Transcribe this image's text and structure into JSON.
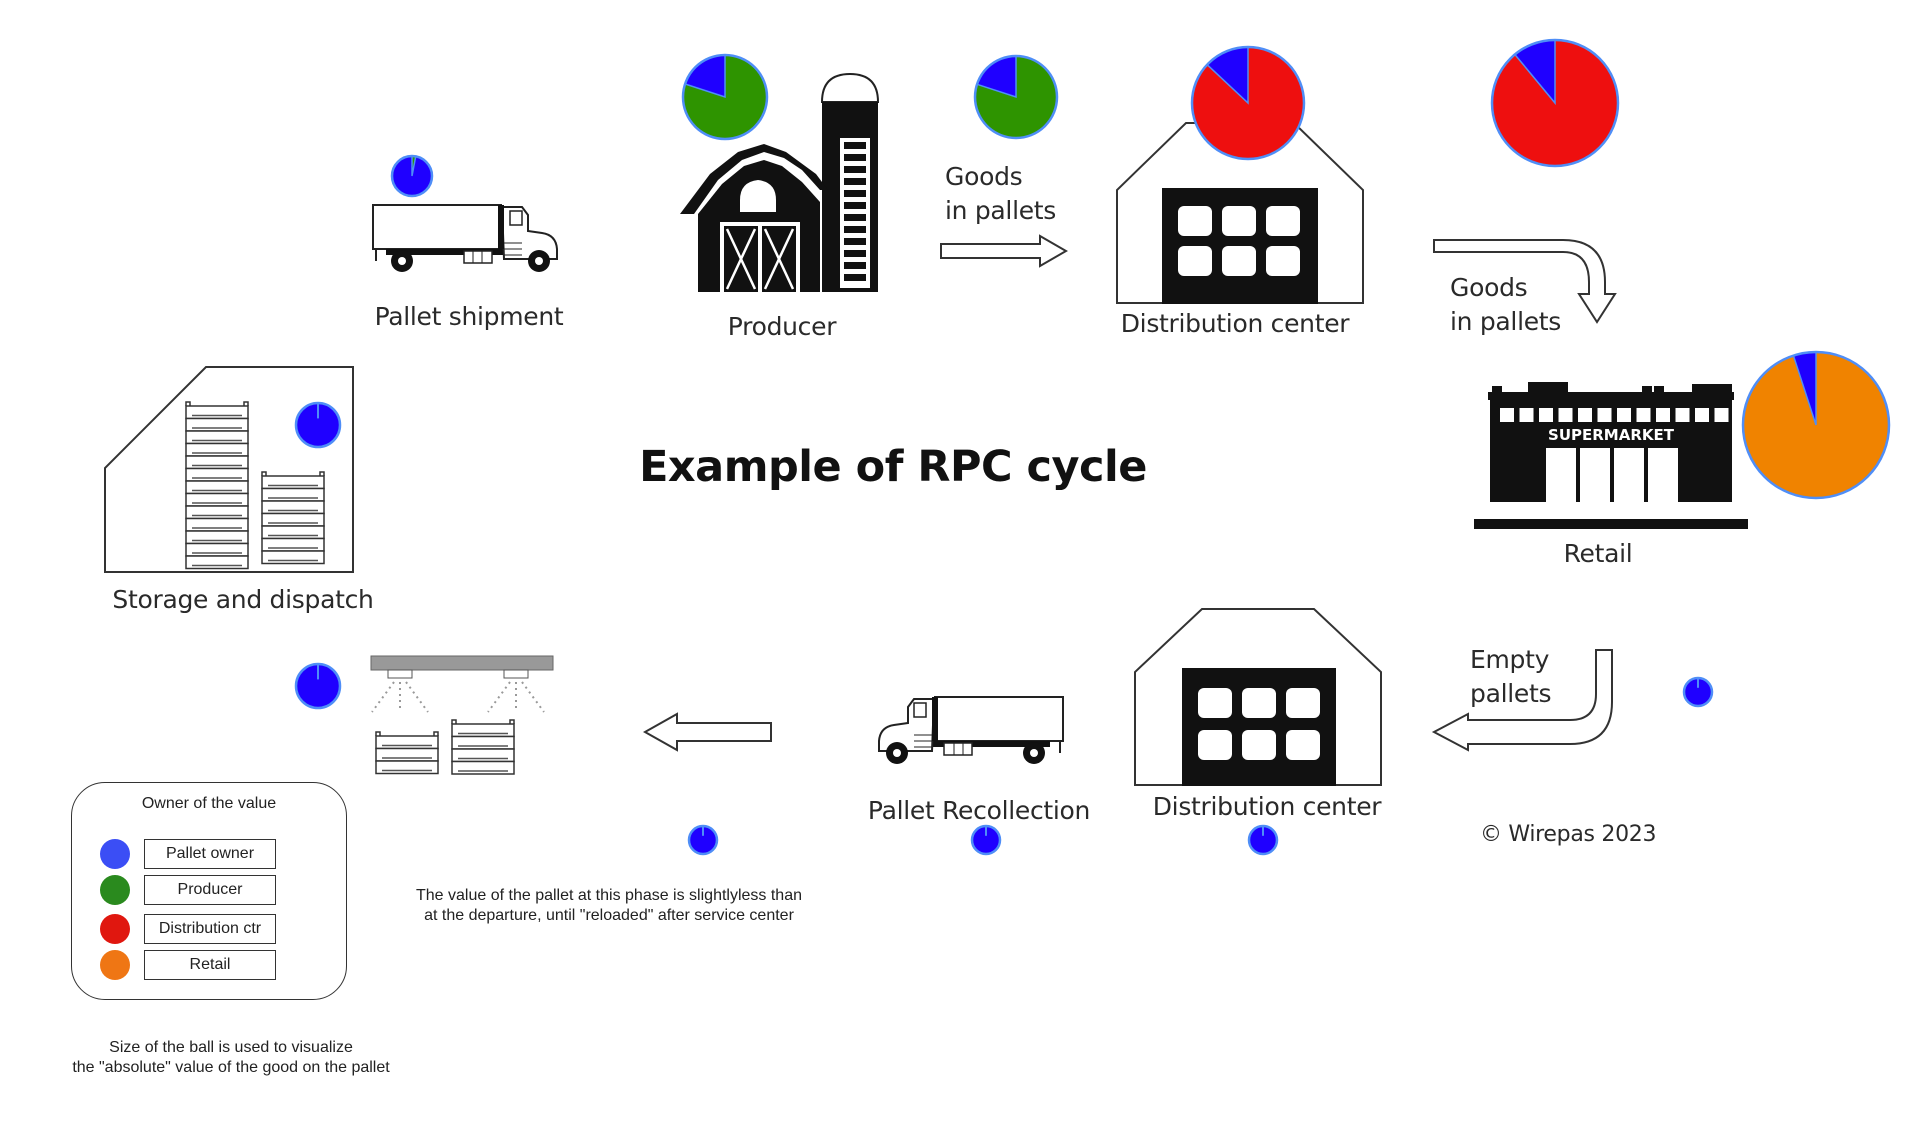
{
  "title": "Example of RPC cycle",
  "colors": {
    "pallet_owner": "#1f00ff",
    "producer": "#2e9400",
    "distribution": "#ee0f0f",
    "retail": "#f08300",
    "pie_outline": "#4f8ef7"
  },
  "stages": {
    "pallet_shipment": {
      "label": "Pallet shipment",
      "shares": {
        "pallet_owner": 0.97,
        "producer": 0.03
      }
    },
    "producer": {
      "label": "Producer",
      "shares": {
        "pallet_owner": 0.2,
        "producer": 0.8
      }
    },
    "goods_transit_1": {
      "label": "Goods\nin pallets",
      "shares": {
        "pallet_owner": 0.2,
        "producer": 0.8
      }
    },
    "distribution_center_in": {
      "label": "Distribution center",
      "shares": {
        "pallet_owner": 0.13,
        "distribution": 0.87
      }
    },
    "goods_transit_2": {
      "label": "Goods\nin pallets",
      "shares": {
        "pallet_owner": 0.11,
        "distribution": 0.89
      }
    },
    "retail": {
      "label": "Retail",
      "shares": {
        "pallet_owner": 0.05,
        "retail": 0.95
      }
    },
    "empty_pallets": {
      "label": "Empty\npallets",
      "shares": {
        "pallet_owner": 1.0
      }
    },
    "distribution_center_out": {
      "label": "Distribution center",
      "shares": {
        "pallet_owner": 1.0
      }
    },
    "pallet_recollection": {
      "label": "Pallet Recollection",
      "shares": {
        "pallet_owner": 1.0
      }
    },
    "service": {
      "shares": {
        "pallet_owner": 1.0
      }
    },
    "service_scanning": {
      "shares": {
        "pallet_owner": 1.0
      }
    },
    "storage_dispatch": {
      "label": "Storage and dispatch",
      "shares": {
        "pallet_owner": 1.0
      }
    }
  },
  "supermarket_sign": "SUPERMARKET",
  "copyright": "© Wirepas 2023",
  "note": {
    "line1": "The value of the pallet at this phase is slightlyless than",
    "line2": "at the departure, until \"reloaded\" after service center"
  },
  "legend": {
    "title": "Owner of the value",
    "items": [
      {
        "label": "Pallet owner",
        "color": "#3b4ef5"
      },
      {
        "label": "Producer",
        "color": "#2a8a1e"
      },
      {
        "label": "Distribution ctr",
        "color": "#e0170f"
      },
      {
        "label": "Retail",
        "color": "#ef7614"
      }
    ]
  },
  "footer": {
    "line1": "Size of the ball is used to visualize",
    "line2": "the \"absolute\" value of the good on the pallet"
  }
}
